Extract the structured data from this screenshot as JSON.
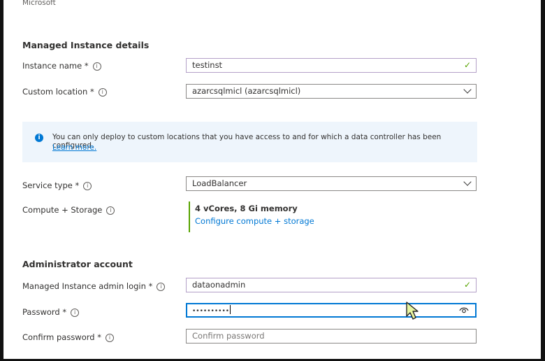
{
  "brand": "Microsoft",
  "sections": {
    "details_title": "Managed Instance details",
    "admin_title": "Administrator account"
  },
  "fields": {
    "instance_name": {
      "label": "Instance name *",
      "value": "testinst"
    },
    "custom_location": {
      "label": "Custom location *",
      "value": "azarcsqlmicl (azarcsqlmicl)"
    },
    "service_type": {
      "label": "Service type *",
      "value": "LoadBalancer"
    },
    "compute_storage": {
      "label": "Compute + Storage",
      "summary": "4 vCores, 8 Gi memory",
      "link": "Configure compute + storage"
    },
    "admin_login": {
      "label": "Managed Instance admin login *",
      "value": "dataonadmin"
    },
    "password": {
      "label": "Password *",
      "value": "••••••••••"
    },
    "confirm_password": {
      "label": "Confirm password *",
      "placeholder": "Confirm password"
    }
  },
  "info_banner": {
    "text": "You can only deploy to custom locations that you have access to and for which a data controller has been configured.",
    "link": "Learn more."
  },
  "icons": {
    "info": "info-circle-icon",
    "check": "checkmark-icon",
    "chevron": "chevron-down-icon",
    "eye": "eye-icon",
    "cursor": "mouse-pointer-icon"
  },
  "colors": {
    "accent": "#0078d4",
    "valid_check": "#57a300",
    "valid_border": "#b4a0c8",
    "banner_bg": "#eef5fc"
  }
}
